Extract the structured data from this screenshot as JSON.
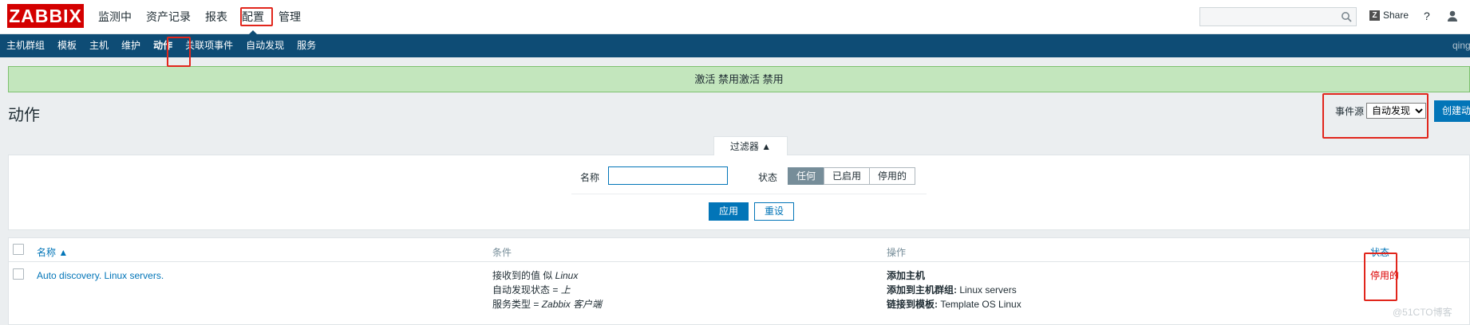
{
  "app": {
    "logo": "ZABBIX"
  },
  "main_menu": [
    {
      "label": "监测中"
    },
    {
      "label": "资产记录"
    },
    {
      "label": "报表"
    },
    {
      "label": "配置"
    },
    {
      "label": "管理"
    }
  ],
  "header": {
    "search_placeholder": "",
    "share_label": "Share",
    "share_icon": "Z",
    "help_label": "?"
  },
  "sub_menu": [
    {
      "label": "主机群组"
    },
    {
      "label": "模板"
    },
    {
      "label": "主机"
    },
    {
      "label": "维护"
    },
    {
      "label": "动作"
    },
    {
      "label": "关联项事件"
    },
    {
      "label": "自动发现"
    },
    {
      "label": "服务"
    }
  ],
  "sub_user": "qing",
  "message": "激活 禁用激活 禁用",
  "page_title": "动作",
  "event_source": {
    "label": "事件源",
    "value": "自动发现",
    "options": [
      "自动发现"
    ]
  },
  "create_button": "创建动作",
  "filter": {
    "tab_label": "过滤器 ▲",
    "name_label": "名称",
    "name_value": "",
    "status_label": "状态",
    "status_options": [
      "任何",
      "已启用",
      "停用的"
    ],
    "status_selected": "任何",
    "apply_label": "应用",
    "reset_label": "重设"
  },
  "table": {
    "headers": {
      "name": "名称 ▲",
      "conditions": "条件",
      "operations": "操作",
      "status": "状态"
    },
    "rows": [
      {
        "name": "Auto discovery. Linux servers.",
        "conditions": [
          {
            "key": "接收到的值 似 ",
            "val": "Linux"
          },
          {
            "key": "自动发现状态 = ",
            "val": "上"
          },
          {
            "key": "服务类型 = ",
            "val": "Zabbix 客户端"
          }
        ],
        "operations": [
          {
            "key": "添加主机",
            "val": ""
          },
          {
            "key": "添加到主机群组: ",
            "val": "Linux servers"
          },
          {
            "key": "链接到模板: ",
            "val": "Template OS Linux"
          }
        ],
        "status": "停用的"
      }
    ]
  },
  "watermark": "@51CTO博客",
  "colors": {
    "brand": "#d40000",
    "nav": "#0e4c75",
    "accent": "#0275b8",
    "success_bg": "#c3e6bd",
    "disabled": "#dc0000",
    "highlight": "#e1261c"
  }
}
